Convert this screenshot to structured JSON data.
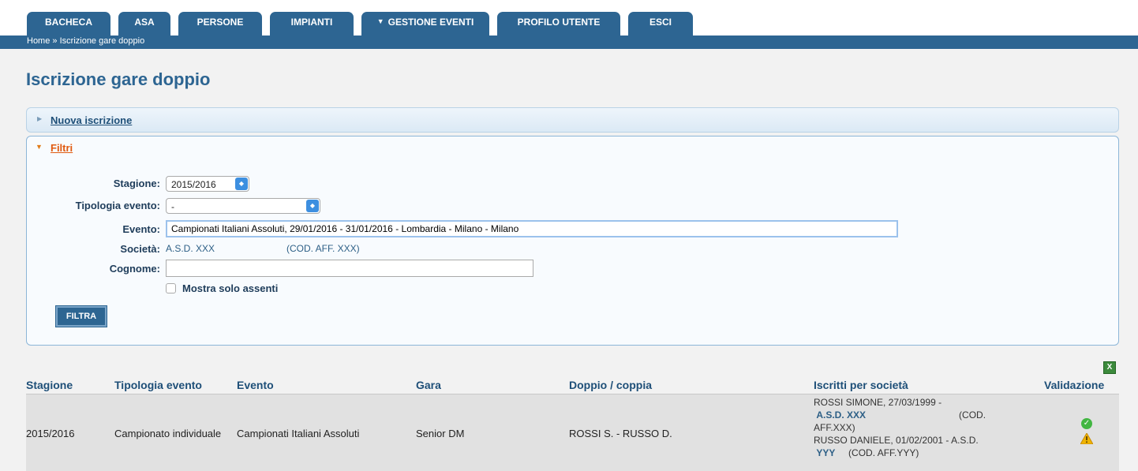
{
  "nav": {
    "tabs": [
      {
        "label": "BACHECA"
      },
      {
        "label": "ASA"
      },
      {
        "label": "PERSONE"
      },
      {
        "label": "IMPIANTI"
      },
      {
        "label": "GESTIONE EVENTI"
      },
      {
        "label": "PROFILO UTENTE"
      },
      {
        "label": "ESCI"
      }
    ],
    "breadcrumb": {
      "home": "Home",
      "sep": "»",
      "current": "Iscrizione gare doppio"
    }
  },
  "page_title": "Iscrizione gare doppio",
  "accordion": {
    "new_label": "Nuova iscrizione",
    "filters_label": "Filtri"
  },
  "filters": {
    "stagione_label": "Stagione:",
    "stagione_value": "2015/2016",
    "tipologia_label": "Tipologia evento:",
    "tipologia_value": "-",
    "evento_label": "Evento:",
    "evento_value": "Campionati Italiani Assoluti, 29/01/2016 - 31/01/2016 - Lombardia - Milano - Milano",
    "societa_label": "Società:",
    "societa_value": "A.S.D. XXX",
    "societa_code": "(COD. AFF. XXX)",
    "cognome_label": "Cognome:",
    "cognome_value": "",
    "checkbox_label": "Mostra solo assenti",
    "button_label": "FILTRA"
  },
  "table": {
    "export_icon": "excel-icon",
    "headers": [
      "Stagione",
      "Tipologia evento",
      "Evento",
      "Gara",
      "Doppio / coppia",
      "Iscritti per società",
      "Validazione"
    ],
    "rows": [
      {
        "stagione": "2015/2016",
        "tipologia": "Campionato individuale",
        "evento": "Campionati Italiani Assoluti",
        "gara": "Senior DM",
        "doppio": "ROSSI S. - RUSSO D.",
        "iscritti": {
          "line1": "ROSSI SIMONE, 27/03/1999 -",
          "soc1": "A.S.D. XXX",
          "cod1": "(COD.",
          "cod1b": "AFF.XXX)",
          "line2": "RUSSO DANIELE, 01/02/2001 - A.S.D.",
          "soc2": "YYY",
          "cod2": "(COD. AFF.YYY)"
        },
        "validation_icons": [
          "check-icon",
          "warning-icon"
        ]
      }
    ]
  },
  "colors": {
    "brand": "#2d6592",
    "accent": "#e05a10",
    "row_bg": "#e1e1e1"
  }
}
